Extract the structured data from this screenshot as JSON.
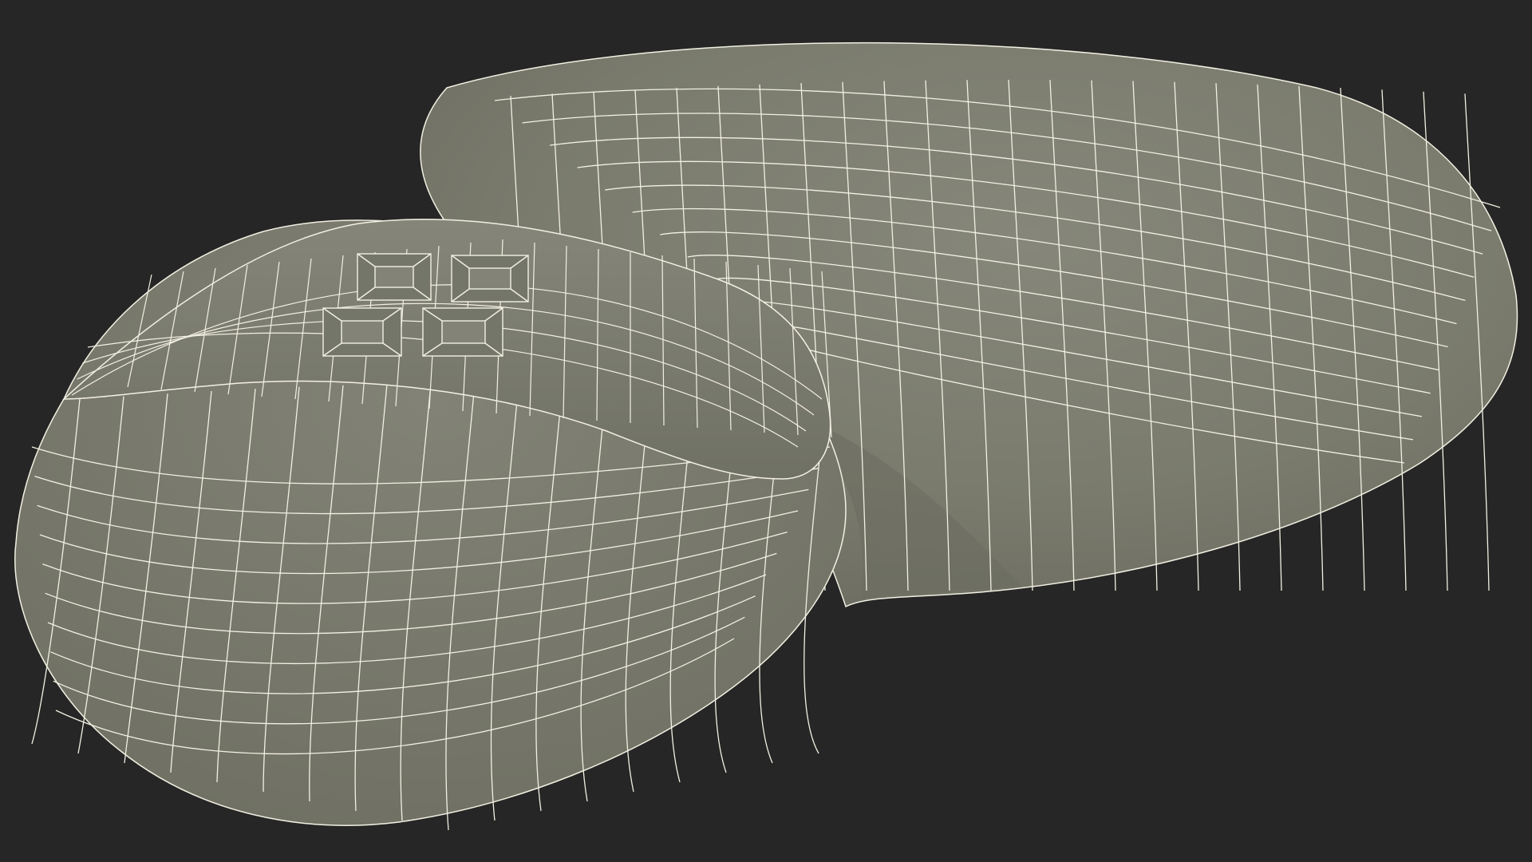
{
  "scene": {
    "subject": "wireframe-3d-mouse-model",
    "colors": {
      "background": "#262626",
      "surface": "#7a7b6d",
      "surface_dark": "#6c6d60",
      "surface_light": "#85867a",
      "wire": "#f2f0e2",
      "shadow": "#55564c"
    }
  }
}
